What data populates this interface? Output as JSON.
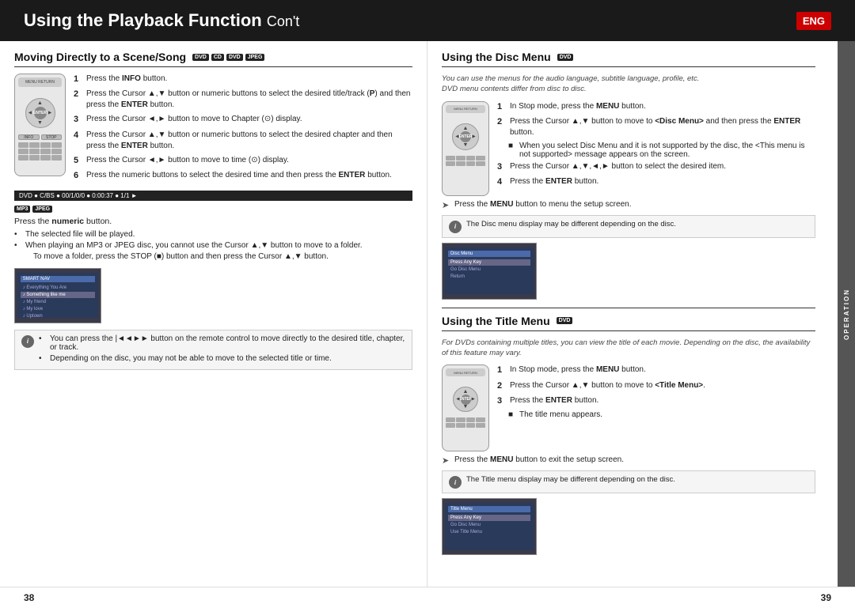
{
  "header": {
    "title": "Using the Playback Function",
    "subtitle": "Con't",
    "eng_badge": "ENG"
  },
  "left_section": {
    "title": "Moving Directly to a Scene/Song",
    "icons": [
      "DVD",
      "CD",
      "DVD",
      "JPEG"
    ],
    "part1": {
      "steps": [
        {
          "num": "1",
          "text": "Press the ",
          "bold": "INFO",
          "text2": " button."
        },
        {
          "num": "2",
          "text": "Press the Cursor ▲,▼ button or numeric buttons to select the desired title/track (",
          "icon": "P",
          "text2": ") and then press the ",
          "bold": "ENTER",
          "text2b": " button."
        },
        {
          "num": "3",
          "text": "Press the Cursor ◄,► button to move to Chapter (",
          "icon": "CH",
          "text2": ") display."
        },
        {
          "num": "4",
          "text": "Press the Cursor ▲,▼ button or numeric buttons to select the desired chapter and then press the ",
          "bold": "ENTER",
          "text2": " button."
        },
        {
          "num": "5",
          "text": "Press the Cursor ◄,► button to move to time (",
          "icon": "T",
          "text2": ") display."
        },
        {
          "num": "6",
          "text": "Press the numeric buttons to select the desired time and then press the ",
          "bold": "ENTER",
          "text2": " button."
        }
      ],
      "disc_strip": "DVD ● C/BS ● 00/1/0/0 ● 0:00:37 ● 1/1 ►"
    },
    "part2": {
      "instruction": "Press the ",
      "bold_word": "numeric",
      "instruction2": " button.",
      "bullets": [
        "The selected file will be played.",
        "When playing an MP3 or JPEG disc, you cannot use the Cursor ▲,▼ button to move to a folder.",
        "To move a folder, press the STOP (■) button and then press the Cursor ▲,▼ button."
      ]
    },
    "note": {
      "bullets": [
        "You can press the |◄◄►► button on the remote control to move directly to the desired title, chapter, or track.",
        "Depending on the disc, you may not be able to move to the selected title or time."
      ]
    }
  },
  "right_disc_section": {
    "title": "Using the Disc Menu",
    "icon": "DVD",
    "intro": "You can use the menus for the audio language, subtitle language, profile, etc.\nDVD menu contents differ from disc to disc.",
    "steps": [
      {
        "num": "1",
        "text": "In Stop mode, press the ",
        "bold": "MENU",
        "text2": " button."
      },
      {
        "num": "2",
        "text": "Press the Cursor ▲,▼ button to move to ",
        "bold": "<Disc Menu>",
        "text2": " and then press the ",
        "bold2": "ENTER",
        "text3": " button."
      },
      {
        "bullet": "When you select Disc Menu and it is not supported by the disc, the <This menu is not supported> message appears on the screen."
      },
      {
        "num": "3",
        "text": "Press the Cursor ▲,▼,◄,► button to select the desired item."
      },
      {
        "num": "4",
        "text": "Press the ",
        "bold": "ENTER",
        "text2": " button."
      }
    ],
    "arrow_note": "Press the MENU button to menu the setup screen.",
    "note": "The Disc menu display may be different depending on the disc.",
    "screen": {
      "title": "Disc Menu",
      "items": [
        "Press Any Key",
        "Go Disc Menu",
        "Return"
      ]
    }
  },
  "right_title_section": {
    "title": "Using the Title Menu",
    "icon": "DVD",
    "intro": "For DVDs containing multiple titles, you can view the title of each movie. Depending on the disc, the availability of this feature may vary.",
    "steps": [
      {
        "num": "1",
        "text": "In Stop mode, press the ",
        "bold": "MENU",
        "text2": " button."
      },
      {
        "num": "2",
        "text": "Press the Cursor ▲,▼ button to move to ",
        "bold": "<Title Menu>",
        "text2": "."
      },
      {
        "num": "3",
        "text": "Press the ",
        "bold": "ENTER",
        "text2": " button."
      },
      {
        "bullet": "The title menu appears."
      }
    ],
    "arrow_note": "Press the MENU button to exit the setup screen.",
    "note": "The Title menu display may be different depending on the disc.",
    "screen": {
      "title": "Title Menu",
      "items": [
        "Press Any Key",
        "Go Disc Menu",
        "Use Title Menu"
      ]
    }
  },
  "page_numbers": {
    "left": "38",
    "right": "39"
  },
  "sidebar": {
    "label": "OPERATION"
  }
}
